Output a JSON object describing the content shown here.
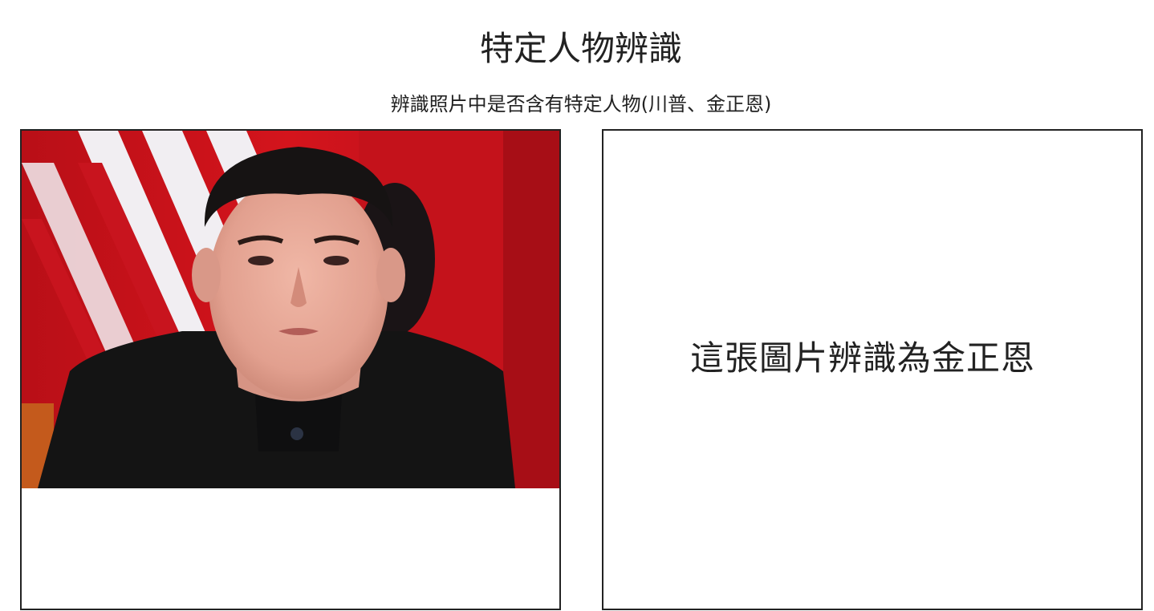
{
  "header": {
    "title": "特定人物辨識",
    "subtitle": "辨識照片中是否含有特定人物(川普、金正恩)"
  },
  "upload_panel": {
    "image_subject": "photo of a man in a dark suit in front of red and white striped flags"
  },
  "result_panel": {
    "text": "這張圖片辨識為金正恩"
  },
  "colors": {
    "border": "#222222",
    "flag_red": "#c8141e",
    "flag_white": "#f1eef2",
    "suit": "#141414",
    "skin": "#e7a89a"
  }
}
